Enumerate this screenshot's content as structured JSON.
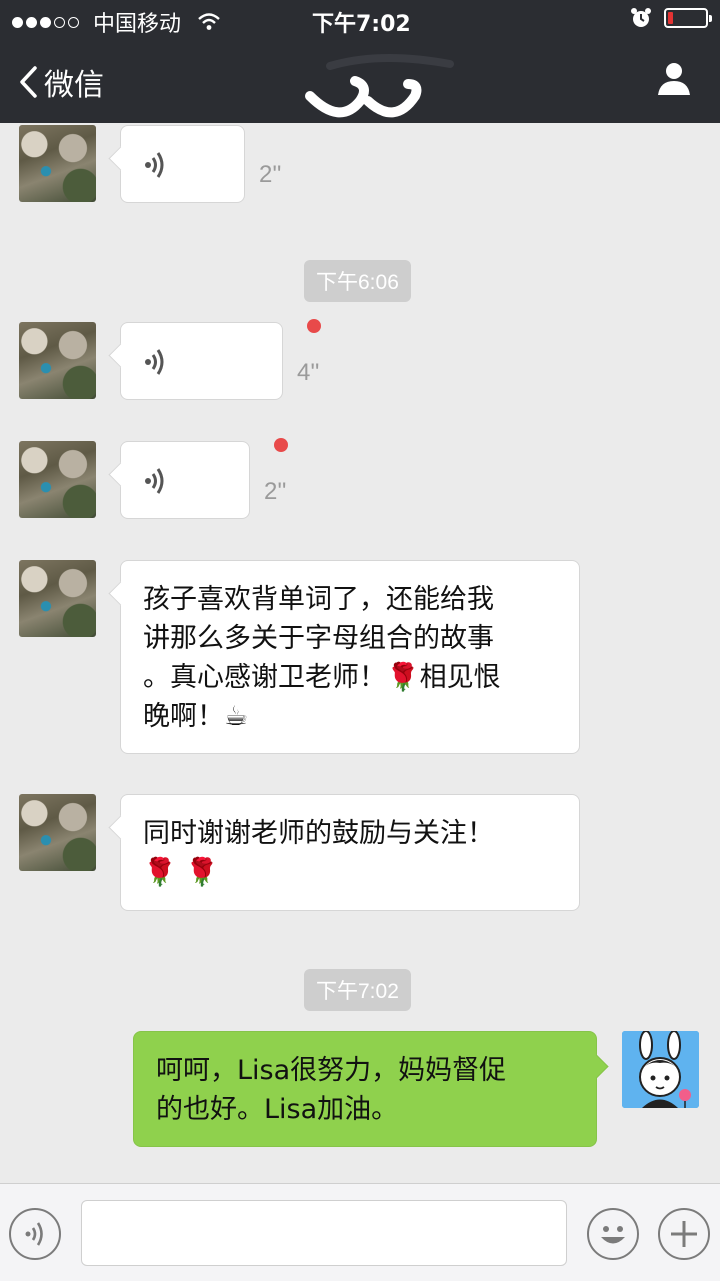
{
  "status_bar": {
    "carrier": "中国移动",
    "time": "下午7:02",
    "battery_level": 0.15,
    "colors": {
      "battery_low": "#e33333"
    }
  },
  "nav": {
    "back_label": "微信",
    "icons": {
      "back": "chevron-left-icon",
      "profile": "person-icon"
    }
  },
  "messages": [
    {
      "type": "voice",
      "side": "left",
      "duration": "2''"
    },
    {
      "type": "time",
      "label": "下午6:06"
    },
    {
      "type": "voice",
      "side": "left",
      "duration": "4''",
      "unread": true
    },
    {
      "type": "voice",
      "side": "left",
      "duration": "2''",
      "unread": true
    },
    {
      "type": "text",
      "side": "left",
      "lines": [
        "孩子喜欢背单词了，还能给我",
        "讲那么多关于字母组合的故事",
        "。真心感谢卫老师！🌹相见恨",
        "晚啊！☕"
      ]
    },
    {
      "type": "text",
      "side": "left",
      "lines": [
        "同时谢谢老师的鼓励与关注！",
        "🌹 🌹"
      ]
    },
    {
      "type": "time",
      "label": "下午7:02"
    },
    {
      "type": "text",
      "side": "right",
      "lines": [
        "呵呵，Lisa很努力，妈妈督促",
        "的也好。Lisa加油。"
      ]
    }
  ],
  "input_bar": {
    "icons": {
      "voice": "voice-mode-icon",
      "emoji": "emoji-icon",
      "more": "plus-icon"
    },
    "text_value": ""
  },
  "colors": {
    "chat_bg": "#ebebeb",
    "nav_bg": "#2b2d32",
    "own_bubble": "#8fd14d",
    "unread_dot": "#e84a4a"
  }
}
